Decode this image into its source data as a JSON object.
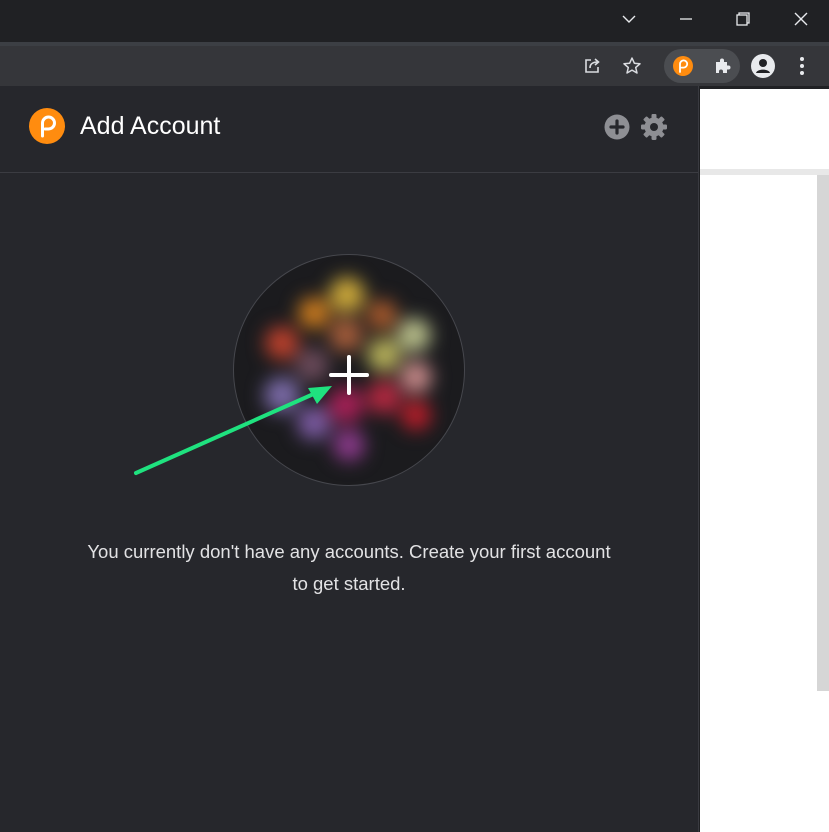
{
  "browser": {
    "window_controls": {
      "tab_search": "chevron-down-icon",
      "minimize": "minimize-icon",
      "restore": "restore-icon",
      "close": "close-icon"
    },
    "toolbar_icons": [
      "share-icon",
      "star-icon",
      "polkadot-extension-icon",
      "puzzle-icon",
      "profile-icon",
      "kebab-menu-icon"
    ]
  },
  "popup": {
    "title": "Add Account",
    "header_actions": [
      "add-circle-icon",
      "gear-icon"
    ],
    "create_account_tooltip": "+",
    "empty_message": "You currently don't have any accounts. Create your first account to get started."
  },
  "colors": {
    "brand": "#ff8c0f",
    "popup_bg": "#26272c",
    "arrow": "#1fe27f"
  }
}
